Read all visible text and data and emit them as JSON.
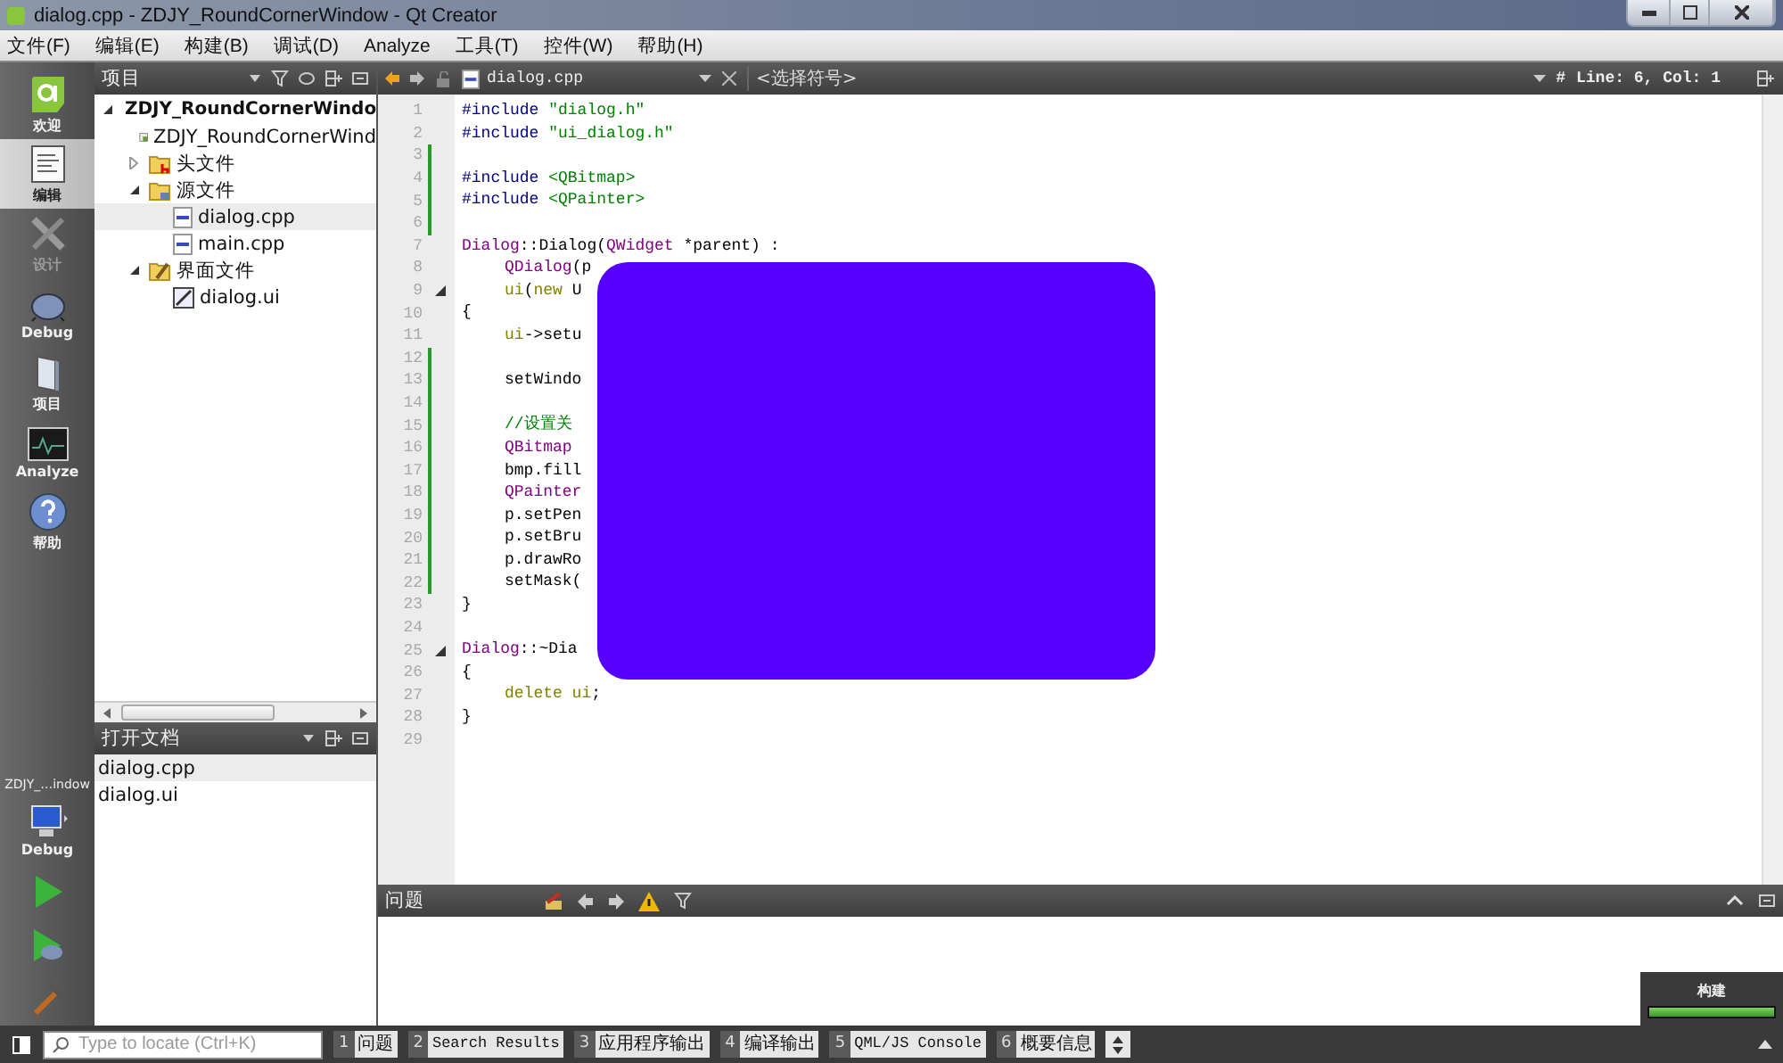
{
  "window": {
    "title": "dialog.cpp - ZDJY_RoundCornerWindow - Qt Creator"
  },
  "menu": [
    "文件(F)",
    "编辑(E)",
    "构建(B)",
    "调试(D)",
    "Analyze",
    "工具(T)",
    "控件(W)",
    "帮助(H)"
  ],
  "modes": [
    {
      "label": "欢迎",
      "kind": "welcome",
      "selected": false,
      "disabled": false
    },
    {
      "label": "编辑",
      "kind": "edit",
      "selected": true,
      "disabled": false
    },
    {
      "label": "设计",
      "kind": "design",
      "selected": false,
      "disabled": true
    },
    {
      "label": "Debug",
      "kind": "debug",
      "selected": false,
      "disabled": false
    },
    {
      "label": "项目",
      "kind": "projects",
      "selected": false,
      "disabled": false
    },
    {
      "label": "Analyze",
      "kind": "analyze",
      "selected": false,
      "disabled": false
    },
    {
      "label": "帮助",
      "kind": "help",
      "selected": false,
      "disabled": false
    }
  ],
  "target": {
    "project": "ZDJY_…indow",
    "label": "Debug"
  },
  "project_panel": {
    "title": "项目",
    "tree": [
      {
        "label": "ZDJY_RoundCornerWindo",
        "kind": "project",
        "expanded": true,
        "selected": false,
        "children": [
          {
            "label": "ZDJY_RoundCornerWind",
            "kind": "pro",
            "selected": false
          },
          {
            "label": "头文件",
            "kind": "headers",
            "expanded": false,
            "selected": false
          },
          {
            "label": "源文件",
            "kind": "sources",
            "expanded": true,
            "selected": false,
            "children": [
              {
                "label": "dialog.cpp",
                "kind": "cpp",
                "selected": true
              },
              {
                "label": "main.cpp",
                "kind": "cpp",
                "selected": false
              }
            ]
          },
          {
            "label": "界面文件",
            "kind": "forms",
            "expanded": true,
            "selected": false,
            "children": [
              {
                "label": "dialog.ui",
                "kind": "ui",
                "selected": false
              }
            ]
          }
        ]
      }
    ]
  },
  "open_documents": {
    "title": "打开文档",
    "items": [
      {
        "label": "dialog.cpp",
        "selected": true
      },
      {
        "label": "dialog.ui",
        "selected": false
      }
    ]
  },
  "editor_toolbar": {
    "file": "dialog.cpp",
    "symbol": "<选择符号>",
    "hash": "#",
    "position": "Line: 6, Col: 1"
  },
  "code": [
    {
      "number": "1",
      "changed": false,
      "tokens": [
        {
          "kind": "pre",
          "text": "#include "
        },
        {
          "kind": "str",
          "text": "\"dialog.h\""
        }
      ]
    },
    {
      "number": "2",
      "changed": false,
      "tokens": [
        {
          "kind": "pre",
          "text": "#include "
        },
        {
          "kind": "str",
          "text": "\"ui_dialog.h\""
        }
      ]
    },
    {
      "number": "3",
      "changed": true
    },
    {
      "number": "4",
      "changed": true,
      "tokens": [
        {
          "kind": "pre",
          "text": "#include "
        },
        {
          "kind": "str",
          "text": "<QBitmap>"
        }
      ]
    },
    {
      "number": "5",
      "changed": true,
      "tokens": [
        {
          "kind": "pre",
          "text": "#include "
        },
        {
          "kind": "str",
          "text": "<QPainter>"
        }
      ]
    },
    {
      "number": "6",
      "changed": true
    },
    {
      "number": "7",
      "changed": false,
      "tokens": [
        {
          "kind": "type",
          "text": "Dialog"
        },
        {
          "kind": "plain",
          "text": "::Dialog("
        },
        {
          "kind": "type",
          "text": "QWidget"
        },
        {
          "kind": "plain",
          "text": " *parent) :"
        }
      ]
    },
    {
      "number": "8",
      "changed": false,
      "indented": true,
      "tokens": [
        {
          "kind": "type",
          "text": "QDialog"
        },
        {
          "kind": "plain",
          "text": "(p"
        }
      ]
    },
    {
      "number": "9",
      "changed": false,
      "fold": true,
      "indented": true,
      "tokens": [
        {
          "kind": "member",
          "text": "ui"
        },
        {
          "kind": "plain",
          "text": "("
        },
        {
          "kind": "member",
          "text": "new"
        },
        {
          "kind": "plain",
          "text": " U"
        }
      ]
    },
    {
      "number": "10",
      "changed": false,
      "tokens": [
        {
          "kind": "plain",
          "text": "{"
        }
      ]
    },
    {
      "number": "11",
      "changed": false,
      "indented": true,
      "tokens": [
        {
          "kind": "member",
          "text": "ui"
        },
        {
          "kind": "plain",
          "text": "->setu"
        }
      ]
    },
    {
      "number": "12",
      "changed": true
    },
    {
      "number": "13",
      "changed": true,
      "indented": true,
      "tokens": [
        {
          "kind": "plain",
          "text": "setWindo"
        }
      ]
    },
    {
      "number": "14",
      "changed": true
    },
    {
      "number": "15",
      "changed": true,
      "indented": true,
      "tokens": [
        {
          "kind": "comment",
          "text": "//设置关"
        }
      ]
    },
    {
      "number": "16",
      "changed": true,
      "indented": true,
      "tokens": [
        {
          "kind": "type",
          "text": "QBitmap"
        }
      ]
    },
    {
      "number": "17",
      "changed": true,
      "indented": true,
      "tokens": [
        {
          "kind": "plain",
          "text": "bmp.fill"
        }
      ]
    },
    {
      "number": "18",
      "changed": true,
      "indented": true,
      "tokens": [
        {
          "kind": "type",
          "text": "QPainter"
        }
      ]
    },
    {
      "number": "19",
      "changed": true,
      "indented": true,
      "tokens": [
        {
          "kind": "plain",
          "text": "p.setPen"
        }
      ]
    },
    {
      "number": "20",
      "changed": true,
      "indented": true,
      "tokens": [
        {
          "kind": "plain",
          "text": "p.setBru"
        }
      ]
    },
    {
      "number": "21",
      "changed": true,
      "indented": true,
      "tokens": [
        {
          "kind": "plain",
          "text": "p.drawRo"
        }
      ]
    },
    {
      "number": "22",
      "changed": true,
      "indented": true,
      "tokens": [
        {
          "kind": "plain",
          "text": "setMask("
        }
      ]
    },
    {
      "number": "23",
      "changed": false,
      "tokens": [
        {
          "kind": "plain",
          "text": "}"
        }
      ]
    },
    {
      "number": "24",
      "changed": false
    },
    {
      "number": "25",
      "changed": false,
      "fold": true,
      "tokens": [
        {
          "kind": "type",
          "text": "Dialog"
        },
        {
          "kind": "plain",
          "text": "::~Dia"
        }
      ]
    },
    {
      "number": "26",
      "changed": false,
      "tokens": [
        {
          "kind": "plain",
          "text": "{"
        }
      ]
    },
    {
      "number": "27",
      "changed": false,
      "indented": true,
      "tokens": [
        {
          "kind": "member",
          "text": "delete ui"
        },
        {
          "kind": "plain",
          "text": ";"
        }
      ]
    },
    {
      "number": "28",
      "changed": false,
      "tokens": [
        {
          "kind": "plain",
          "text": "}"
        }
      ]
    },
    {
      "number": "29",
      "changed": false
    }
  ],
  "overlay_window": {
    "color": "#5500ff"
  },
  "issues_panel": {
    "title": "问题"
  },
  "build": {
    "label": "构建",
    "level": 1
  },
  "status_bar": {
    "locate_placeholder": "Type to locate (Ctrl+K)",
    "tabs": [
      {
        "number": "1",
        "label": "问题"
      },
      {
        "number": "2",
        "label": "Search Results"
      },
      {
        "number": "3",
        "label": "应用程序输出"
      },
      {
        "number": "4",
        "label": "编译输出"
      },
      {
        "number": "5",
        "label": "QML/JS Console"
      },
      {
        "number": "6",
        "label": "概要信息"
      }
    ]
  }
}
